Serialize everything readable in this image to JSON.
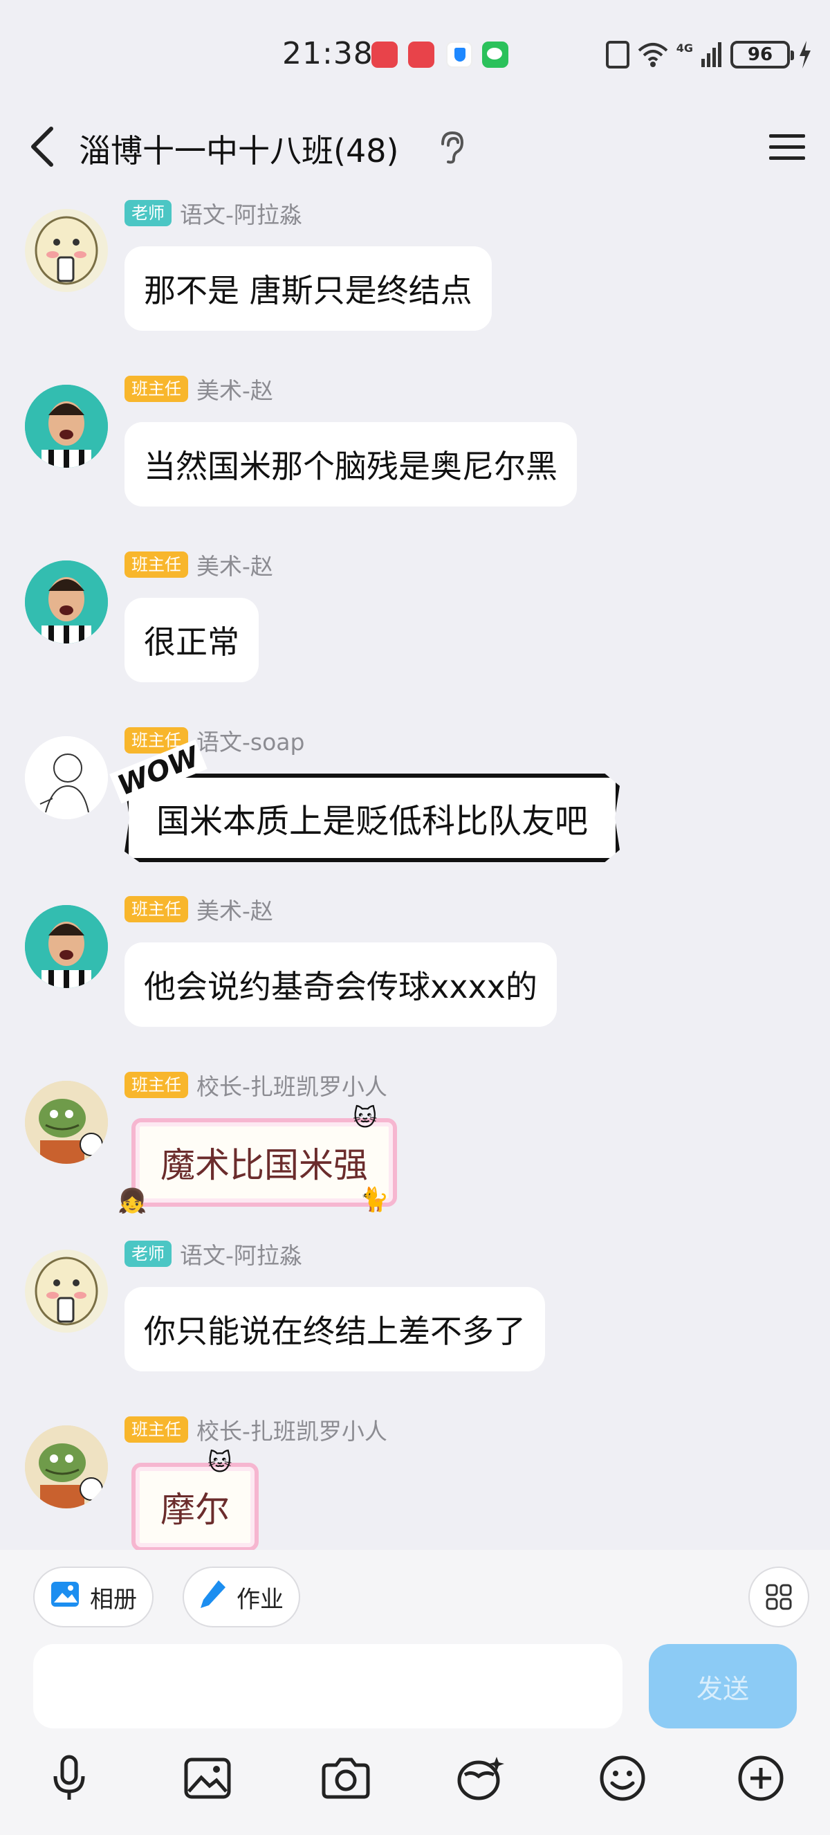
{
  "status_bar": {
    "time": "21:38",
    "network": "4G",
    "battery": "96"
  },
  "header": {
    "title": "淄博十一中十八班(48)"
  },
  "messages": [
    {
      "badge": "老师",
      "sender": "语文-阿拉淼",
      "text": "那不是 唐斯只是终结点",
      "style": "plain",
      "avatar": "hand-drawn-face-avatar"
    },
    {
      "badge": "班主任",
      "sender": "美术-赵",
      "text": "当然国米那个脑残是奥尼尔黑",
      "style": "plain",
      "avatar": "footballer-avatar"
    },
    {
      "badge": "班主任",
      "sender": "美术-赵",
      "text": "很正常",
      "style": "plain",
      "avatar": "footballer-avatar"
    },
    {
      "badge": "班主任",
      "sender": "语文-soap",
      "text": "国米本质上是贬低科比队友吧",
      "style": "comic",
      "wow": "WOW",
      "avatar": "line-sketch-avatar"
    },
    {
      "badge": "班主任",
      "sender": "美术-赵",
      "text": "他会说约基奇会传球xxxx的",
      "style": "plain",
      "avatar": "footballer-avatar"
    },
    {
      "badge": "班主任",
      "sender": "校长-扎班凯罗小人",
      "text": "魔术比国米强",
      "style": "sticker",
      "avatar": "frog-avatar"
    },
    {
      "badge": "老师",
      "sender": "语文-阿拉淼",
      "text": "你只能说在终结上差不多了",
      "style": "plain",
      "avatar": "hand-drawn-face-avatar"
    },
    {
      "badge": "班主任",
      "sender": "校长-扎班凯罗小人",
      "text": "摩尔",
      "style": "sticker",
      "avatar": "frog-avatar"
    }
  ],
  "composer": {
    "album_label": "相册",
    "homework_label": "作业",
    "input_placeholder": "",
    "send_label": "发送"
  },
  "colors": {
    "teacher_badge": "#4bc6c4",
    "head_teacher_badge": "#f8b62c",
    "send_button": "#8ccbf5",
    "background": "#efeff4"
  }
}
